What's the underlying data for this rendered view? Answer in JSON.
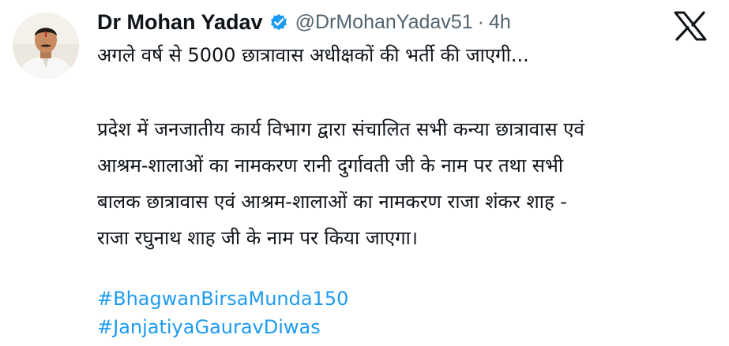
{
  "tweet": {
    "author": {
      "display_name": "Dr Mohan Yadav",
      "handle": "@DrMohanYadav51",
      "separator": "·",
      "time": "4h",
      "avatar_icon": "profile-photo",
      "verified_icon": "verified-badge-icon",
      "verified_color": "#1d9bf0"
    },
    "platform_icon": "x-logo-icon",
    "headline": "अगले वर्ष से 5000 छात्रावास अधीक्षकों की भर्ती की जाएगी...",
    "body_lines": [
      "प्रदेश में जनजातीय कार्य विभाग द्वारा संचालित सभी कन्या छात्रावास एवं",
      "आश्रम-शालाओं का नामकरण रानी दुर्गावती जी के नाम पर तथा सभी",
      "बालक छात्रावास एवं आश्रम-शालाओं का नामकरण राजा शंकर शाह -",
      "राजा रघुनाथ शाह जी के नाम पर किया जाएगा।"
    ],
    "hashtags": [
      "#BhagwanBirsaMunda150",
      "#JanjatiyaGauravDiwas"
    ],
    "colors": {
      "text": "#0f1419",
      "muted": "#536471",
      "link": "#1d9bf0",
      "background": "#ffffff"
    }
  }
}
